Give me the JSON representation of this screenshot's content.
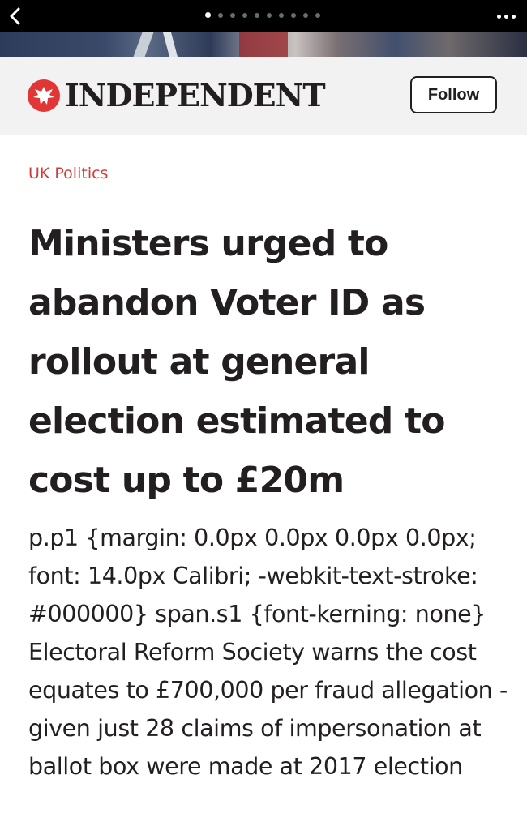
{
  "topbar": {
    "back_icon": "chevron-left-icon",
    "page_count": 10,
    "active_page": 1,
    "more_icon": "ellipsis-icon"
  },
  "publisher": {
    "logo_icon": "eagle-icon",
    "name": "INDEPENDENT",
    "follow_label": "Follow",
    "brand_color": "#e23636"
  },
  "article": {
    "section": "UK Politics",
    "section_color": "#d13a36",
    "headline": "Ministers urged to abandon Voter ID as rollout at general election estimated to cost up to £20m",
    "summary": "p.p1 {margin: 0.0px 0.0px 0.0px 0.0px; font: 14.0px Calibri; -webkit-text-stroke: #000000} span.s1 {font-kerning: none} Electoral Reform Society warns the cost equates to £700,000 per fraud allegation - given just 28 claims of impersonation at ballot box were made at 2017 election"
  }
}
